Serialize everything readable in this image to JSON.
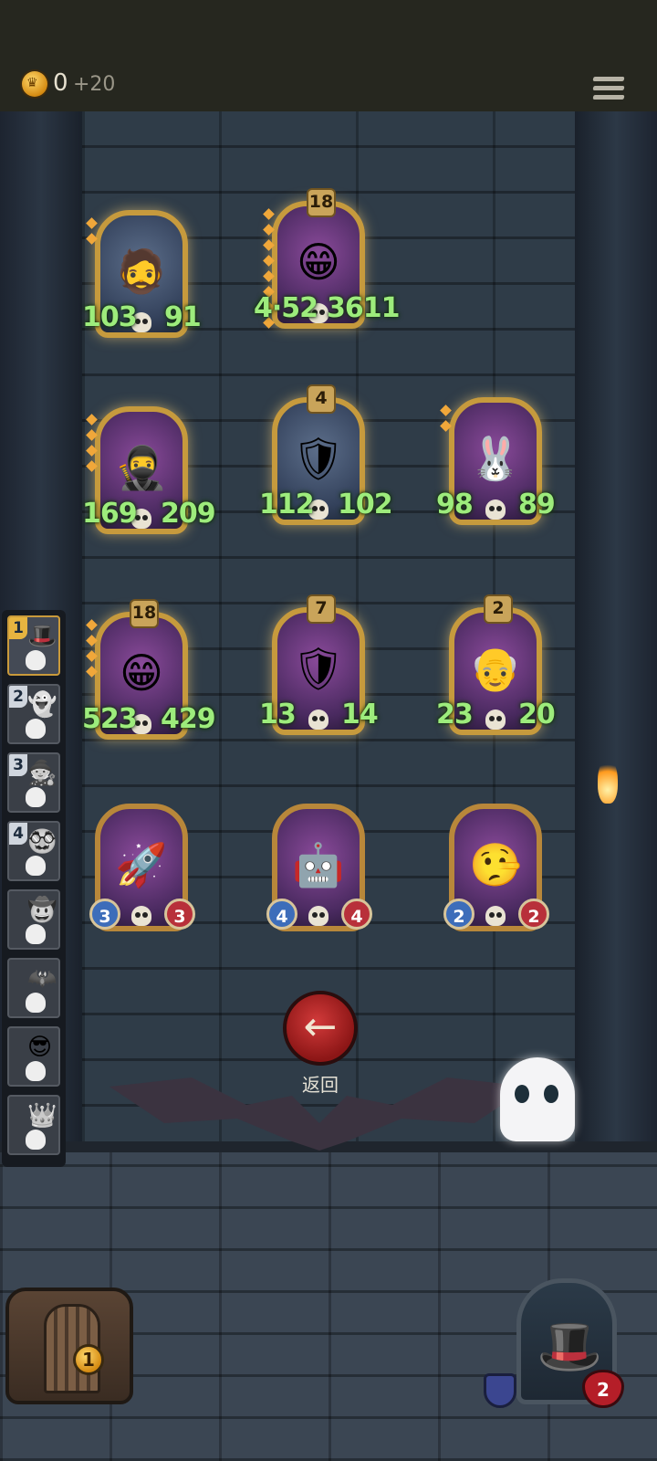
{
  "header": {
    "gold": "0",
    "gold_bonus": "+20",
    "menu_icon": "hamburger-menu-icon"
  },
  "cards": [
    {
      "id": "c1",
      "portrait": "🧔",
      "level": "",
      "gems": 2,
      "atk": "103",
      "hp": "91",
      "buffed": true,
      "green": true
    },
    {
      "id": "c2",
      "portrait": "😁",
      "level": "18",
      "gems": 8,
      "atk": "4·52",
      "hp": "3611",
      "buffed": true
    },
    {
      "id": "c3",
      "portrait": "🥷",
      "level": "",
      "gems": 4,
      "atk": "169",
      "hp": "209",
      "buffed": true
    },
    {
      "id": "c4",
      "portrait": "🛡",
      "level": "4",
      "gems": 0,
      "atk": "112",
      "hp": "102",
      "buffed": true,
      "green": true
    },
    {
      "id": "c5",
      "portrait": "🐰",
      "level": "",
      "gems": 2,
      "atk": "98",
      "hp": "89",
      "buffed": true
    },
    {
      "id": "c6",
      "portrait": "😁",
      "level": "18",
      "gems": 4,
      "atk": "523",
      "hp": "429",
      "buffed": true
    },
    {
      "id": "c7",
      "portrait": "🛡",
      "level": "7",
      "gems": 0,
      "atk": "13",
      "hp": "14",
      "buffed": true
    },
    {
      "id": "c8",
      "portrait": "👴",
      "level": "2",
      "gems": 0,
      "atk": "23",
      "hp": "20",
      "buffed": true
    },
    {
      "id": "c9",
      "portrait": "🚀",
      "level": "",
      "gems": 0,
      "atk": "3",
      "hp": "3",
      "buffed": false
    },
    {
      "id": "c10",
      "portrait": "🤖",
      "level": "",
      "gems": 0,
      "atk": "4",
      "hp": "4",
      "buffed": false
    },
    {
      "id": "c11",
      "portrait": "🤥",
      "level": "",
      "gems": 0,
      "atk": "2",
      "hp": "2",
      "buffed": false
    }
  ],
  "sidebar": [
    {
      "num": "1",
      "face": "🎩"
    },
    {
      "num": "2",
      "face": "👻"
    },
    {
      "num": "3",
      "face": "🧙"
    },
    {
      "num": "4",
      "face": "🥸"
    },
    {
      "num": "",
      "face": "🤠"
    },
    {
      "num": "",
      "face": "🦇"
    },
    {
      "num": "",
      "face": "😎"
    },
    {
      "num": "",
      "face": "👑"
    }
  ],
  "back": {
    "label": "返回",
    "icon": "←"
  },
  "chest": {
    "count": "1"
  },
  "player": {
    "lives": "2",
    "portrait": "🎩"
  }
}
